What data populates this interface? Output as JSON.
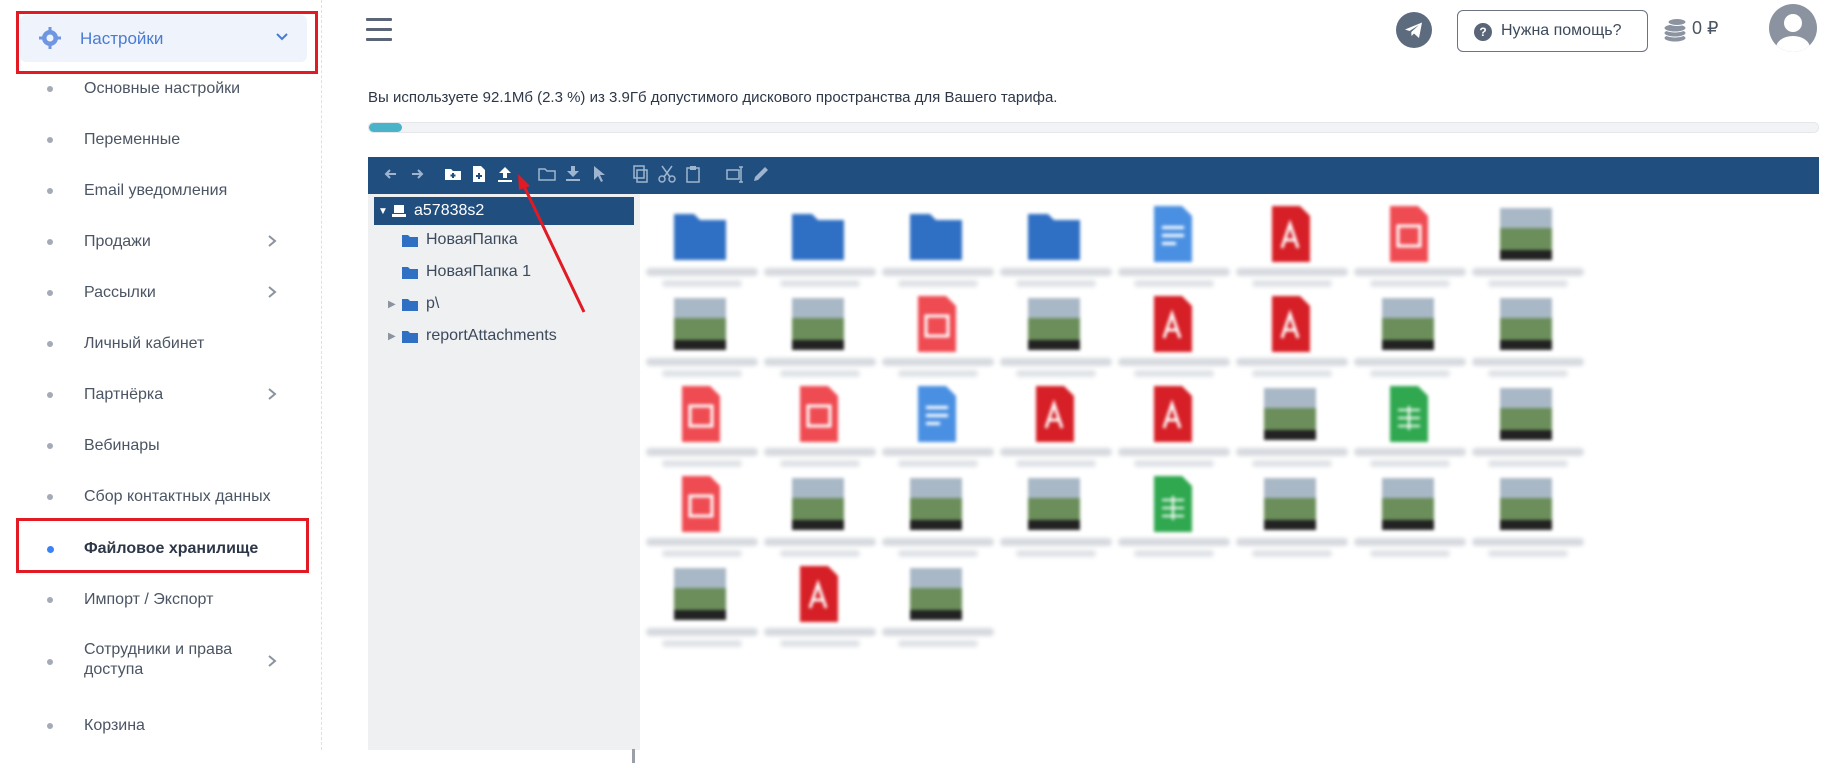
{
  "sidebar": {
    "header_label": "Настройки",
    "items": [
      {
        "label": "Основные настройки",
        "has_children": false,
        "active": false
      },
      {
        "label": "Переменные",
        "has_children": false,
        "active": false
      },
      {
        "label": "Email уведомления",
        "has_children": false,
        "active": false
      },
      {
        "label": "Продажи",
        "has_children": true,
        "active": false
      },
      {
        "label": "Рассылки",
        "has_children": true,
        "active": false
      },
      {
        "label": "Личный кабинет",
        "has_children": false,
        "active": false
      },
      {
        "label": "Партнёрка",
        "has_children": true,
        "active": false
      },
      {
        "label": "Вебинары",
        "has_children": false,
        "active": false
      },
      {
        "label": "Сбор контактных данных",
        "has_children": false,
        "active": false
      },
      {
        "label": "Файловое хранилище",
        "has_children": false,
        "active": true
      },
      {
        "label": "Импорт / Экспорт",
        "has_children": false,
        "active": false
      },
      {
        "label": "Сотрудники и права доступа",
        "has_children": true,
        "active": false
      },
      {
        "label": "Корзина",
        "has_children": false,
        "active": false
      }
    ]
  },
  "topbar": {
    "help_label": "Нужна помощь?",
    "balance": "0 ₽"
  },
  "storage": {
    "usage_text": "Вы используете 92.1Мб (2.3 %) из 3.9Гб допустимого дискового пространства для Вашего тарифа.",
    "usage_percent": 2.3
  },
  "file_manager": {
    "toolbar_icons": [
      "back-icon",
      "forward-icon",
      "new-folder-icon",
      "new-file-icon",
      "upload-icon",
      "open-folder-icon",
      "download-icon",
      "select-icon",
      "copy-icon",
      "cut-icon",
      "paste-icon",
      "rename-icon",
      "edit-icon"
    ],
    "tree": {
      "root": "a57838s2",
      "children": [
        {
          "label": "НоваяПапка",
          "expandable": false
        },
        {
          "label": "НоваяПапка 1",
          "expandable": false
        },
        {
          "label": "p\\",
          "expandable": true
        },
        {
          "label": "reportAttachments",
          "expandable": true
        }
      ]
    },
    "files": [
      "folder",
      "folder",
      "folder",
      "folder",
      "doc",
      "pdf",
      "pdf-light",
      "image",
      "image",
      "image",
      "pdf-light",
      "image",
      "pdf",
      "pdf",
      "image",
      "image",
      "pdf-light",
      "pdf-light",
      "doc",
      "pdf",
      "pdf",
      "image",
      "sheet",
      "image",
      "pdf-light",
      "image",
      "image",
      "image",
      "sheet",
      "image",
      "image",
      "image",
      "image",
      "pdf",
      "image"
    ]
  },
  "colors": {
    "accent": "#1f4e7f",
    "highlight": "#e11a23",
    "progress": "#4ab3c9",
    "sidebar_active_bg": "#eef3fc"
  }
}
